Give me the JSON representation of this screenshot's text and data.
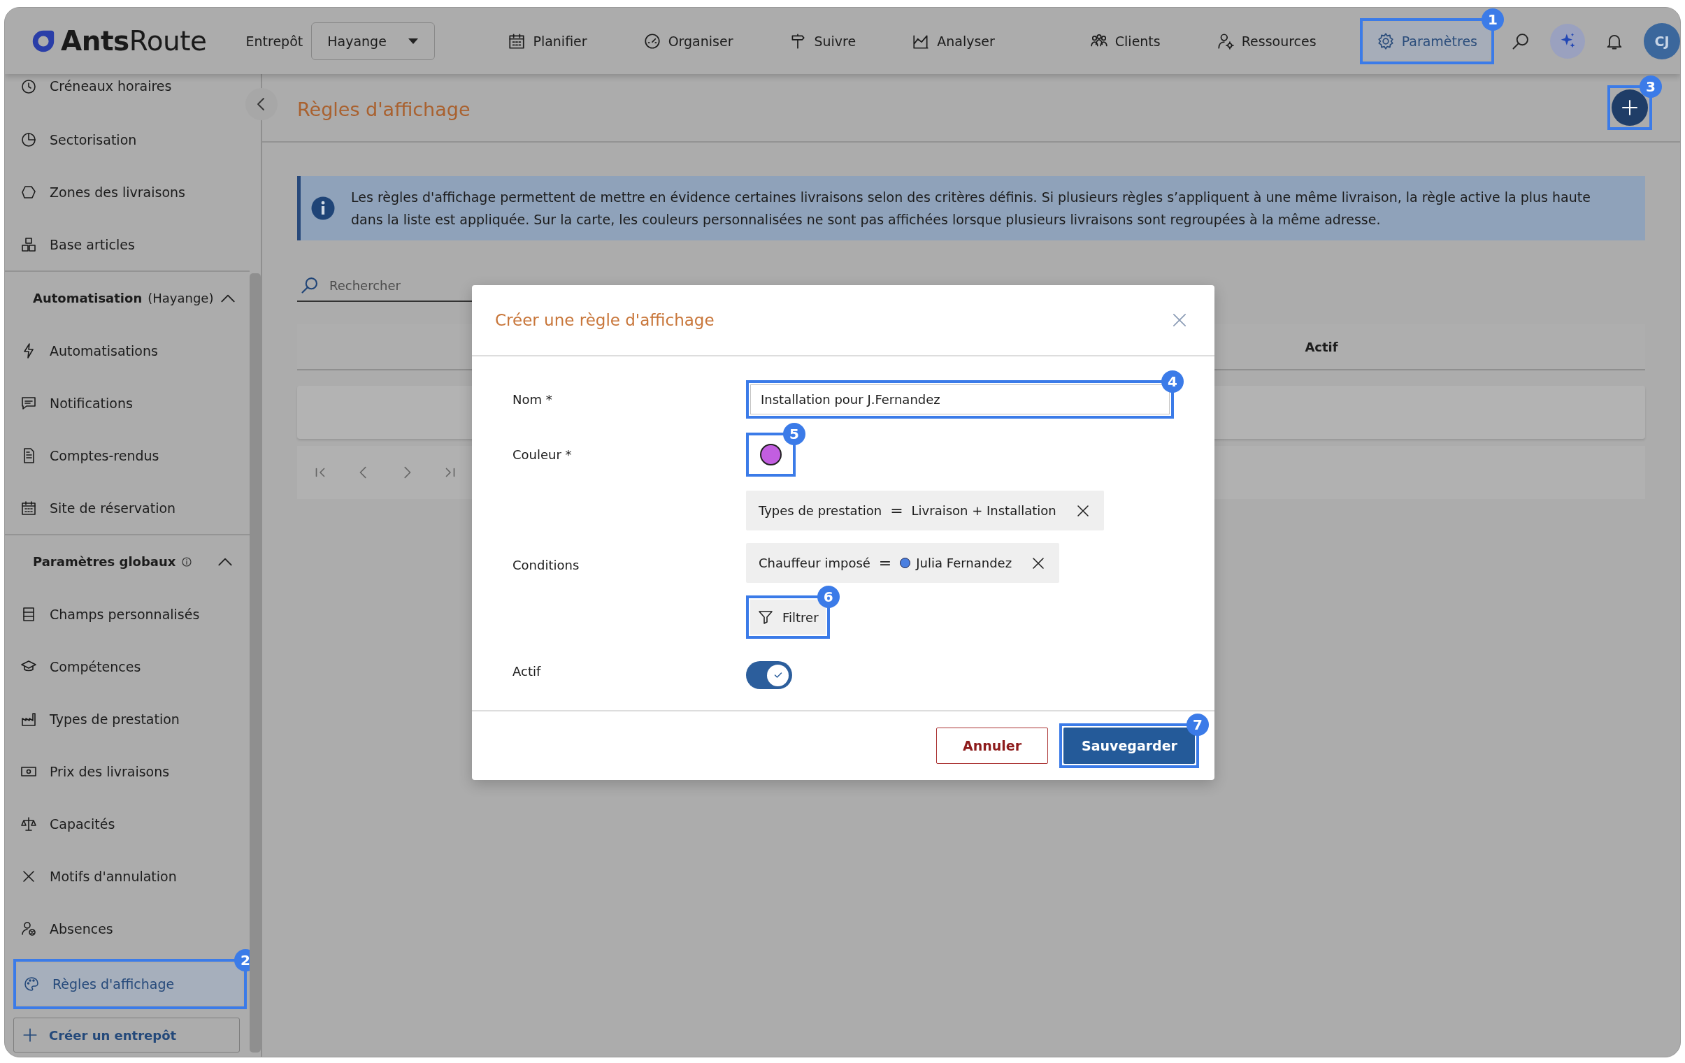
{
  "app": {
    "logo": "**Ants**Route"
  },
  "warehouse": {
    "label": "Entrepôt",
    "value": "Hayange"
  },
  "nav": [
    {
      "label": "Planifier",
      "selected": false
    },
    {
      "label": "Organiser",
      "selected": false
    },
    {
      "label": "Suivre",
      "selected": false
    },
    {
      "label": "Analyser",
      "selected": false
    },
    {
      "label": "Clients",
      "selected": false
    },
    {
      "label": "Ressources",
      "selected": false
    },
    {
      "label": "Paramètres",
      "selected": true,
      "callout": "1"
    }
  ],
  "user": {
    "initials": "CJ"
  },
  "sidebar": {
    "items": [
      {
        "label": "Créneaux horaires",
        "selected": false
      },
      {
        "label": "Sectorisation",
        "selected": false
      },
      {
        "label": "Zones des livraisons",
        "selected": false
      },
      {
        "label": "Base articles",
        "selected": false
      }
    ],
    "sections": [
      {
        "title": "Automatisation",
        "scope": "(Hayange)",
        "has_info": false,
        "expanded": true,
        "items": [
          {
            "label": "Automatisations",
            "selected": false
          },
          {
            "label": "Notifications",
            "selected": false
          },
          {
            "label": "Comptes-rendus",
            "selected": false
          },
          {
            "label": "Site de réservation",
            "selected": false
          }
        ]
      },
      {
        "title": "Paramètres globaux",
        "has_info": true,
        "expanded": true,
        "items": [
          {
            "label": "Champs personnalisés",
            "selected": false
          },
          {
            "label": "Compétences",
            "selected": false
          },
          {
            "label": "Types de prestation",
            "selected": false
          },
          {
            "label": "Prix des livraisons",
            "selected": false
          },
          {
            "label": "Capacités",
            "selected": false
          },
          {
            "label": "Motifs d'annulation",
            "selected": false
          },
          {
            "label": "Absences",
            "selected": false
          },
          {
            "label": "Règles d'affichage",
            "selected": true,
            "callout": "2"
          }
        ]
      }
    ],
    "create_button": {
      "label": "Créer un entrepôt"
    }
  },
  "page": {
    "title": "Règles d'affichage",
    "add_button": {
      "callout": "3"
    },
    "info": "Les règles d'affichage permettent de mettre en évidence certaines livraisons selon des critères définis. Si plusieurs règles s’appliquent à une même livraison, la règle active la plus haute dans la liste est appliquée. Sur la carte, les couleurs personnalisées ne sont pas affichées lorsque plusieurs livraisons sont regroupées à la même adresse.",
    "search": {
      "placeholder": "Rechercher"
    },
    "table": {
      "columns": [
        {
          "label": "Actif"
        }
      ]
    }
  },
  "modal": {
    "title": "Créer une règle d'affichage",
    "fields": [
      {
        "kind": "text",
        "label": "Nom *",
        "value": "Installation pour J.Fernandez",
        "callout": "4"
      },
      {
        "kind": "color",
        "label": "Couleur *",
        "color": "#c25ee0",
        "callout": "5"
      },
      {
        "kind": "conditions",
        "label": "Conditions",
        "conditions": [
          {
            "field": "Types de prestation",
            "operator": "=",
            "value": "Livraison + Installation"
          },
          {
            "field": "Chauffeur imposé",
            "operator": "=",
            "value": "Julia Fernandez",
            "color": "#4a7fe0"
          }
        ],
        "filter_button": {
          "label": "Filtrer",
          "callout": "6"
        }
      },
      {
        "kind": "toggle",
        "label": "Actif",
        "on": true
      }
    ],
    "buttons": [
      {
        "kind": "secondary",
        "label": "Annuler"
      },
      {
        "kind": "primary",
        "label": "Sauvegarder",
        "callout": "7"
      }
    ]
  }
}
